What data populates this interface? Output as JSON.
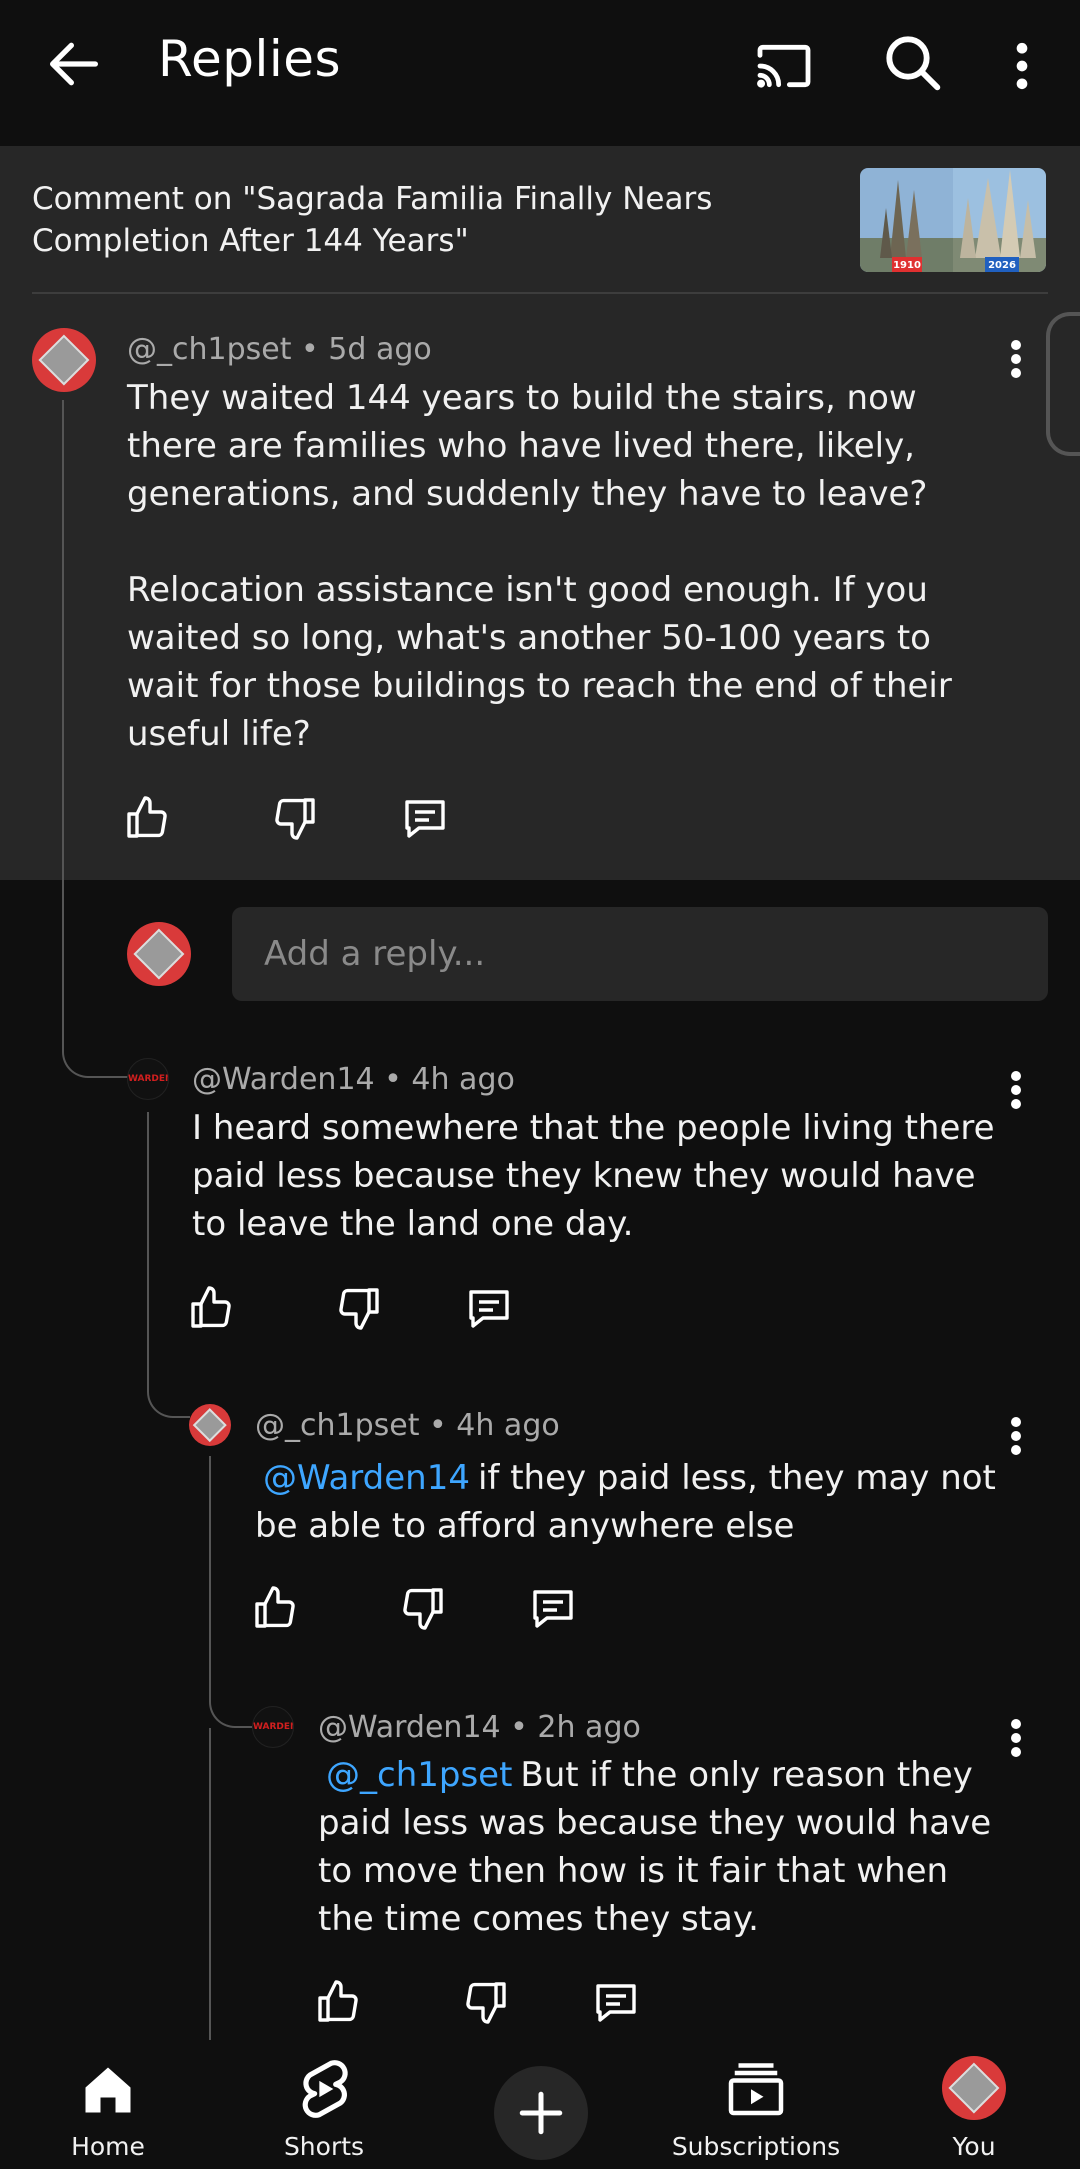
{
  "header": {
    "title": "Replies"
  },
  "context": {
    "text": "Comment on \"Sagrada Familia Finally Nears Completion After 144 Years\"",
    "thumb_left_year": "1910",
    "thumb_right_year": "2026"
  },
  "comments": [
    {
      "handle": "@_ch1pset",
      "time": "5d ago",
      "text": "They waited 144 years to build the stairs, now there are families who have lived there, likely, generations, and suddenly they have to leave?\n\nRelocation assistance isn't good enough. If you waited so long, what's another 50-100 years to wait for those buildings to reach the end of their useful life?"
    },
    {
      "handle": "@Warden14",
      "time": "4h ago",
      "text": "I heard somewhere that the people living there paid less because they knew they would have to leave the land one day."
    },
    {
      "handle": "@_ch1pset",
      "time": "4h ago",
      "mention": "@Warden14",
      "text": "if they paid less, they may not be able to afford anywhere else"
    },
    {
      "handle": "@Warden14",
      "time": "2h ago",
      "mention": "@_ch1pset",
      "text": "But if the only reason they paid less was because they would have to move then how is it fair that when the time comes they stay."
    }
  ],
  "meta_sep": "•",
  "reply_box": {
    "placeholder": "Add a reply..."
  },
  "avatar_logo_text": "WARDEN",
  "nav": {
    "home": "Home",
    "shorts": "Shorts",
    "subscriptions": "Subscriptions",
    "you": "You"
  },
  "colors": {
    "background": "#0f0f0f",
    "surface": "#272727",
    "mention": "#3ea6ff",
    "avatar_red": "#d93a3a"
  }
}
